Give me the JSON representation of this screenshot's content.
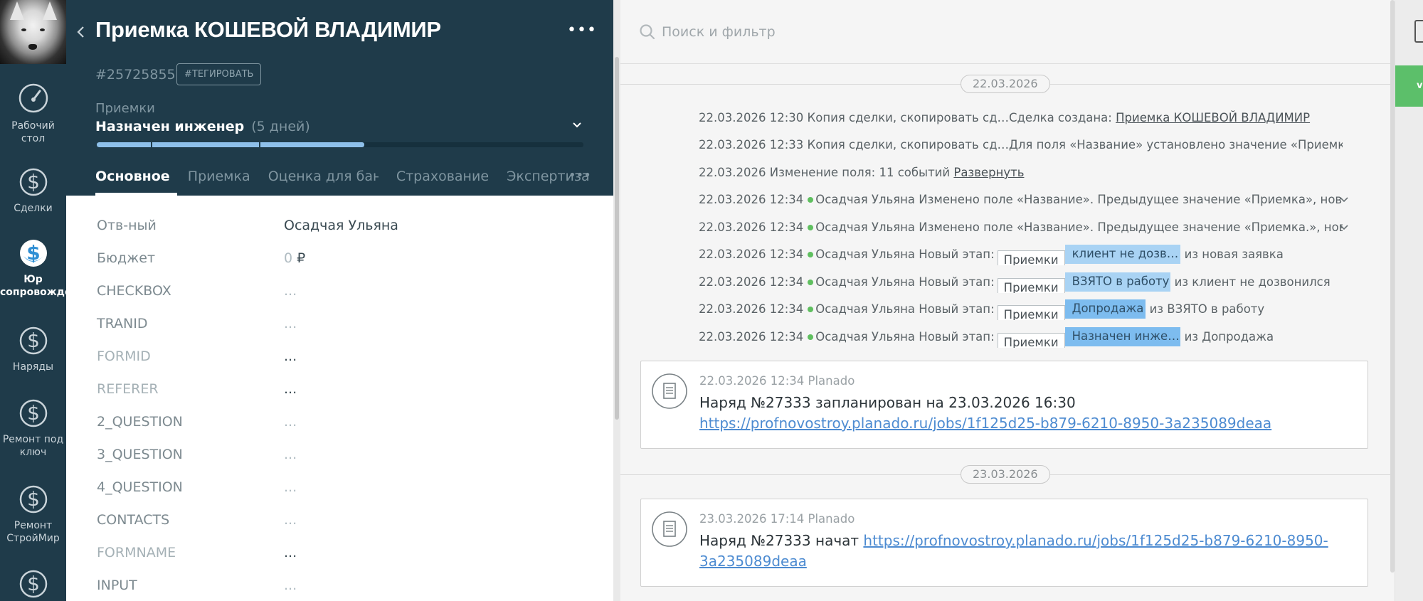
{
  "nav": {
    "items": [
      {
        "label_1": "Рабочий",
        "label_2": "стол",
        "icon": "dashboard-gauge-icon"
      },
      {
        "label_1": "Сделки",
        "label_2": "",
        "icon": "dollar-icon"
      },
      {
        "label_1": "Юр",
        "label_2": "сопровожде",
        "icon": "dollar-icon",
        "active": true
      },
      {
        "label_1": "Наряды",
        "label_2": "",
        "icon": "dollar-icon"
      },
      {
        "label_1": "Ремонт под",
        "label_2": "ключ",
        "icon": "dollar-icon"
      },
      {
        "label_1": "Ремонт",
        "label_2": "СтройМир",
        "icon": "dollar-icon"
      }
    ]
  },
  "card": {
    "title": "Приемка КОШЕВОЙ ВЛАДИМИР",
    "deal_id": "#25725855",
    "tag_button": "#ТЕГИРОВАТЬ",
    "pipeline": "Приемки",
    "stage": "Назначен инженер",
    "stage_days": "(5 дней)",
    "progress_fraction": 0.55,
    "tabs": [
      "Основное",
      "Приемка",
      "Оценка для бані",
      "Страхование",
      "Экспертиза"
    ],
    "fields": [
      {
        "label": "Отв-ный",
        "value": "Осадчая Ульяна"
      },
      {
        "label": "Бюджет",
        "value": "0",
        "currency": "₽"
      },
      {
        "label": "CHECKBOX",
        "value": "..."
      },
      {
        "label": "TRANID",
        "value": "..."
      },
      {
        "label": "FORMID",
        "value": "..."
      },
      {
        "label": "REFERER",
        "value": "..."
      },
      {
        "label": "2_QUESTION",
        "value": "..."
      },
      {
        "label": "3_QUESTION",
        "value": "..."
      },
      {
        "label": "4_QUESTION",
        "value": "..."
      },
      {
        "label": "CONTACTS",
        "value": "..."
      },
      {
        "label": "FORMNAME",
        "value": "..."
      },
      {
        "label": "INPUT",
        "value": "..."
      }
    ]
  },
  "feed": {
    "search_placeholder": "Поиск и фильтр",
    "date1": "22.03.2026",
    "date2": "23.03.2026",
    "e1": {
      "time": "22.03.2026 12:30",
      "text": "Копия сделки, скопировать сд…Сделка создана:",
      "link": "Приемка КОШЕВОЙ ВЛАДИМИР"
    },
    "e2": {
      "time": "22.03.2026 12:33",
      "text": "Копия сделки, скопировать сд…Для поля «Название» установлено значение «Приемка»"
    },
    "e3": {
      "time": "22.03.2026",
      "text": "Изменение поля: 11 событий",
      "link": "Развернуть"
    },
    "e4": {
      "time": "22.03.2026 12:34",
      "author": "Осадчая Ульяна",
      "text": "Изменено поле «Название». Предыдущее значение «Приемка», новое значе"
    },
    "e5": {
      "time": "22.03.2026 12:34",
      "author": "Осадчая Ульяна",
      "text": "Изменено поле «Название». Предыдущее значение «Приемка.», новое значе"
    },
    "new_stage_label": "Новый этап:",
    "stage_changes": [
      {
        "time": "22.03.2026 12:34",
        "author": "Осадчая Ульяна",
        "pipeline": "Приемки",
        "stage": "клиент не дозв…",
        "from": "из новая заявка"
      },
      {
        "time": "22.03.2026 12:34",
        "author": "Осадчая Ульяна",
        "pipeline": "Приемки",
        "stage": "ВЗЯТО в работу",
        "from": "из клиент не дозвонился"
      },
      {
        "time": "22.03.2026 12:34",
        "author": "Осадчая Ульяна",
        "pipeline": "Приемки",
        "stage": "Допродажа",
        "from": "из ВЗЯТО в работу"
      },
      {
        "time": "22.03.2026 12:34",
        "author": "Осадчая Ульяна",
        "pipeline": "Приемки",
        "stage": "Назначен инже…",
        "from": "из Допродажа"
      }
    ],
    "note1": {
      "meta": "22.03.2026 12:34 Planado",
      "text": "Наряд №27333 запланирован на 23.03.2026 16:30",
      "link": "https://profnovostroy.planado.ru/jobs/1f125d25-b879-6210-8950-3a235089deaa"
    },
    "note2": {
      "meta": "23.03.2026 17:14 Planado",
      "text": "Наряд №27333 начат",
      "link_1": "https://profnovostroy.planado.ru/jobs/1f125d25-b879-6210-8950-",
      "link_2": "3a235089deaa"
    }
  },
  "colors": {
    "nav_bg": "#1f3b4a",
    "stage_blue": "#a9d3f4",
    "stage_blue_active": "#7dbcef",
    "activity_green": "#5fbf5f",
    "link_blue": "#4d8bd1",
    "right_button_green": "#5cbf6a"
  },
  "right_strip": {
    "button_label": "v"
  }
}
